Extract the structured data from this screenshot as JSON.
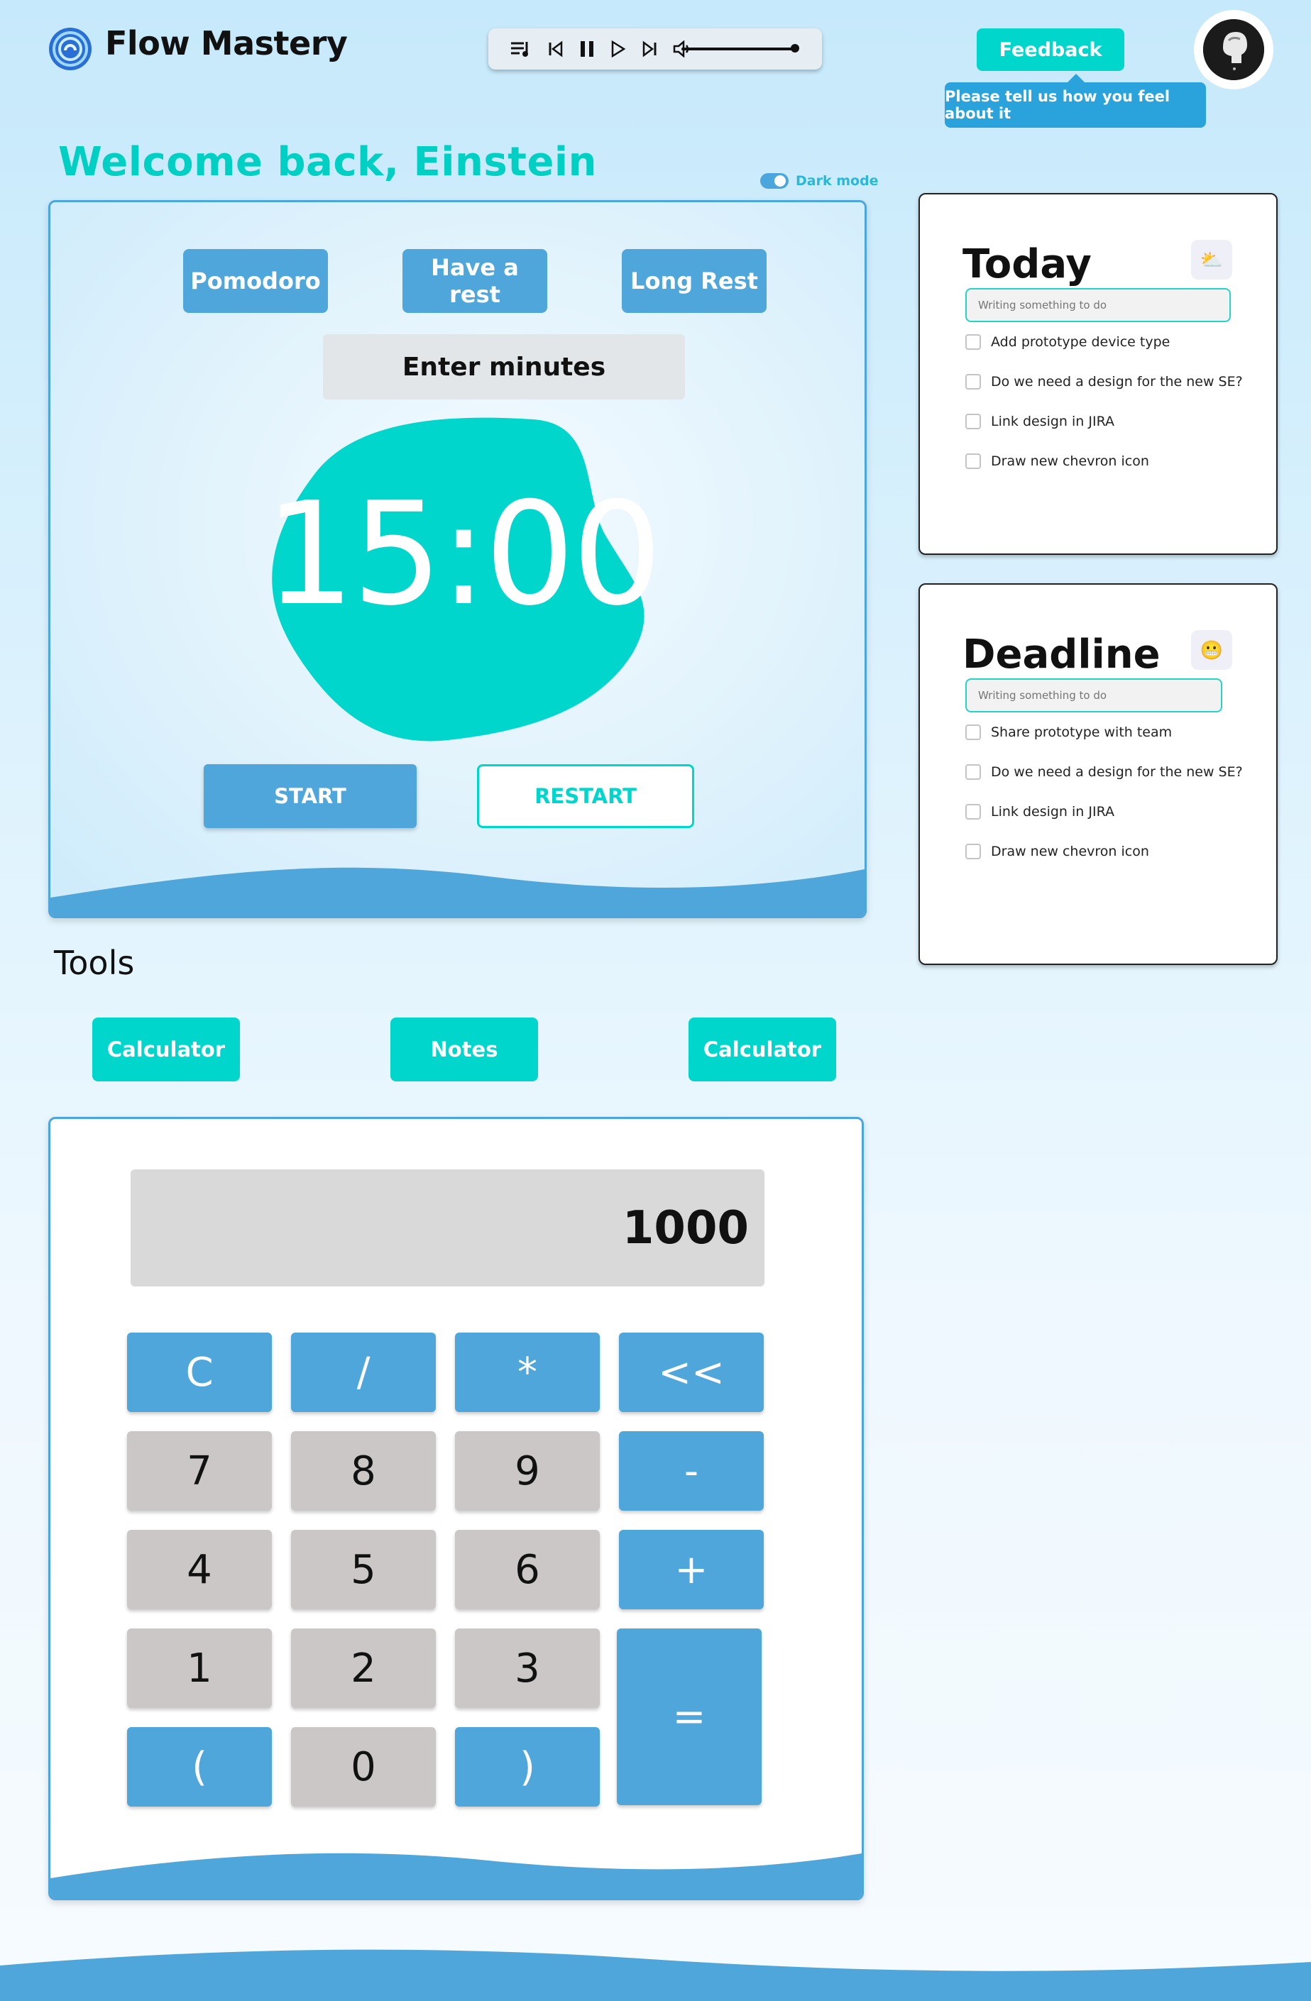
{
  "header": {
    "brand": "Flow Mastery",
    "feedback_label": "Feedback",
    "feedback_tooltip": "Please tell us how you feel about it",
    "player_icons": [
      "playlist-icon",
      "skip-back-icon",
      "pause-icon",
      "play-icon",
      "skip-forward-icon",
      "volume-icon"
    ],
    "volume_level": 1.0
  },
  "welcome": "Welcome back, Einstein",
  "dark_mode_label": "Dark mode",
  "timer": {
    "modes": [
      "Pomodoro",
      "Have a rest",
      "Long Rest"
    ],
    "minutes_placeholder": "Enter minutes",
    "time": "15:00",
    "start_label": "START",
    "restart_label": "RESTART"
  },
  "tools": {
    "title": "Tools",
    "buttons": [
      "Calculator",
      "Notes",
      "Calculator"
    ]
  },
  "calculator": {
    "display": "1000",
    "keys": {
      "clear": "C",
      "divide": "/",
      "multiply": "*",
      "backspace": "<<",
      "seven": "7",
      "eight": "8",
      "nine": "9",
      "minus": "-",
      "four": "4",
      "five": "5",
      "six": "6",
      "plus": "+",
      "one": "1",
      "two": "2",
      "three": "3",
      "equals": "=",
      "lparen": "(",
      "zero": "0",
      "rparen": ")"
    }
  },
  "today": {
    "title": "Today",
    "emoji": "⛅",
    "input_placeholder": "Writing something to do",
    "items": [
      "Add prototype device type",
      "Do we need a design for the new SE?",
      "Link design in JIRA",
      "Draw new chevron icon"
    ]
  },
  "deadline": {
    "title": "Deadline",
    "emoji": "😬",
    "input_placeholder": "Writing something to do",
    "items": [
      "Share prototype with team",
      "Do we need a design for the new SE?",
      "Link design in JIRA",
      "Draw new chevron icon"
    ]
  },
  "colors": {
    "accent_teal": "#00d6cb",
    "accent_blue": "#4fa6db",
    "key_gray": "#cbc7c6"
  }
}
